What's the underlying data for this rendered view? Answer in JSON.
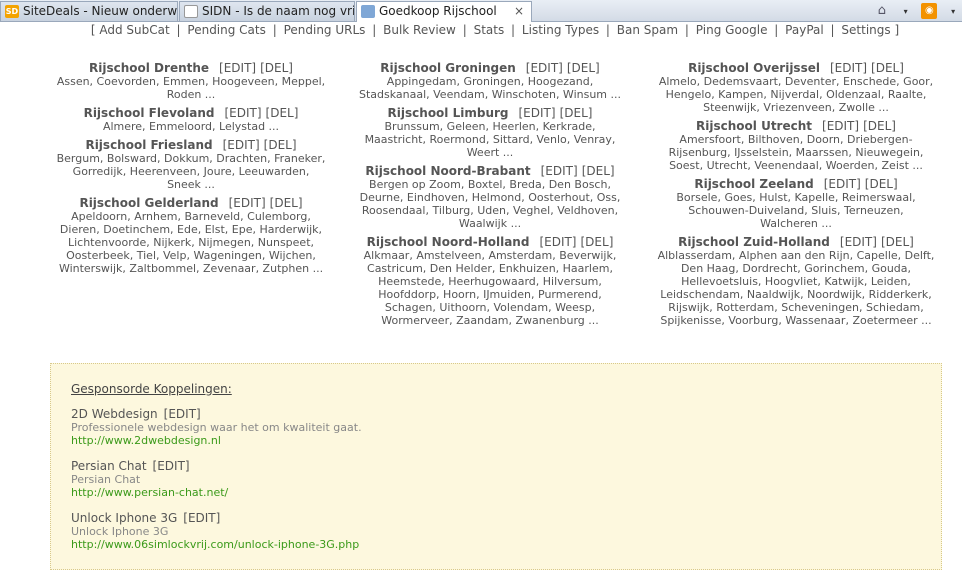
{
  "browser": {
    "tabs": [
      {
        "title": "SiteDeals - Nieuw onderwe...",
        "favicon": "sitedeals-icon"
      },
      {
        "title": "SIDN - Is de naam nog vrij?",
        "favicon": "sidn-icon"
      },
      {
        "title": "Goedkoop Rijschool",
        "favicon": "site-icon",
        "active": true
      }
    ],
    "close_glyph": "×",
    "home_glyph": "⌂",
    "rss_glyph": "◉",
    "dropdown_glyph": "▾"
  },
  "admin_nav": {
    "open": "[",
    "close": "]",
    "separator": "|",
    "items": [
      "Add SubCat",
      "Pending Cats",
      "Pending URLs",
      "Bulk Review",
      "Stats",
      "Listing Types",
      "Ban Spam",
      "Ping Google",
      "PayPal",
      "Settings"
    ]
  },
  "actions": {
    "edit": "[EDIT]",
    "del": "[DEL]"
  },
  "columns": [
    [
      {
        "title": "Rijschool Drenthe",
        "lines": [
          "Assen, Coevorden, Emmen, Hoogeveen, Meppel,",
          "Roden ..."
        ]
      },
      {
        "title": "Rijschool Flevoland",
        "lines": [
          "Almere, Emmeloord, Lelystad ..."
        ]
      },
      {
        "title": "Rijschool Friesland",
        "lines": [
          "Bergum, Bolsward, Dokkum, Drachten, Franeker,",
          "Gorredijk, Heerenveen, Joure, Leeuwarden,",
          "Sneek ..."
        ]
      },
      {
        "title": "Rijschool Gelderland",
        "lines": [
          "Apeldoorn, Arnhem, Barneveld, Culemborg,",
          "Dieren, Doetinchem, Ede, Elst, Epe, Harderwijk,",
          "Lichtenvoorde, Nijkerk, Nijmegen, Nunspeet,",
          "Oosterbeek, Tiel, Velp, Wageningen, Wijchen,",
          "Winterswijk, Zaltbommel, Zevenaar, Zutphen ..."
        ]
      }
    ],
    [
      {
        "title": "Rijschool Groningen",
        "lines": [
          "Appingedam, Groningen, Hoogezand,",
          "Stadskanaal, Veendam, Winschoten, Winsum ..."
        ]
      },
      {
        "title": "Rijschool Limburg",
        "lines": [
          "Brunssum, Geleen, Heerlen, Kerkrade,",
          "Maastricht, Roermond, Sittard, Venlo, Venray,",
          "Weert ..."
        ]
      },
      {
        "title": "Rijschool Noord-Brabant",
        "lines": [
          "Bergen op Zoom, Boxtel, Breda, Den Bosch,",
          "Deurne, Eindhoven, Helmond, Oosterhout, Oss,",
          "Roosendaal, Tilburg, Uden, Veghel, Veldhoven,",
          "Waalwijk ..."
        ]
      },
      {
        "title": "Rijschool Noord-Holland",
        "lines": [
          "Alkmaar, Amstelveen, Amsterdam, Beverwijk,",
          "Castricum, Den Helder, Enkhuizen, Haarlem,",
          "Heemstede, Heerhugowaard, Hilversum,",
          "Hoofddorp, Hoorn, IJmuiden, Purmerend,",
          "Schagen, Uithoorn, Volendam, Weesp,",
          "Wormerveer, Zaandam, Zwanenburg ..."
        ]
      }
    ],
    [
      {
        "title": "Rijschool Overijssel",
        "lines": [
          "Almelo, Dedemsvaart, Deventer, Enschede, Goor,",
          "Hengelo, Kampen, Nijverdal, Oldenzaal, Raalte,",
          "Steenwijk, Vriezenveen, Zwolle ..."
        ]
      },
      {
        "title": "Rijschool Utrecht",
        "lines": [
          "Amersfoort, Bilthoven, Doorn, Driebergen-",
          "Rijsenburg, IJsselstein, Maarssen, Nieuwegein,",
          "Soest, Utrecht, Veenendaal, Woerden, Zeist ..."
        ]
      },
      {
        "title": "Rijschool Zeeland",
        "lines": [
          "Borsele, Goes, Hulst, Kapelle, Reimerswaal,",
          "Schouwen-Duiveland, Sluis, Terneuzen,",
          "Walcheren ..."
        ]
      },
      {
        "title": "Rijschool Zuid-Holland",
        "lines": [
          "Alblasserdam, Alphen aan den Rijn, Capelle, Delft,",
          "Den Haag, Dordrecht, Gorinchem, Gouda,",
          "Hellevoetsluis, Hoogvliet, Katwijk, Leiden,",
          "Leidschendam, Naaldwijk, Noordwijk, Ridderkerk,",
          "Rijswijk, Rotterdam, Scheveningen, Schiedam,",
          "Spijkenisse, Voorburg, Wassenaar, Zoetermeer ..."
        ]
      }
    ]
  ],
  "sponsored": {
    "heading": "Gesponsorde Koppelingen:",
    "items": [
      {
        "name": "2D Webdesign",
        "edit": "[EDIT]",
        "description": "Professionele webdesign waar het om kwaliteit gaat.",
        "url": "http://www.2dwebdesign.nl"
      },
      {
        "name": "Persian Chat",
        "edit": "[EDIT]",
        "description": "Persian Chat",
        "url": "http://www.persian-chat.net/"
      },
      {
        "name": "Unlock Iphone 3G",
        "edit": "[EDIT]",
        "description": "Unlock Iphone 3G",
        "url": "http://www.06simlockvrij.com/unlock-iphone-3G.php"
      }
    ]
  },
  "colors": {
    "link_green": "#3b9a1a",
    "sponsored_bg": "#fdf8de",
    "text": "#555555"
  }
}
